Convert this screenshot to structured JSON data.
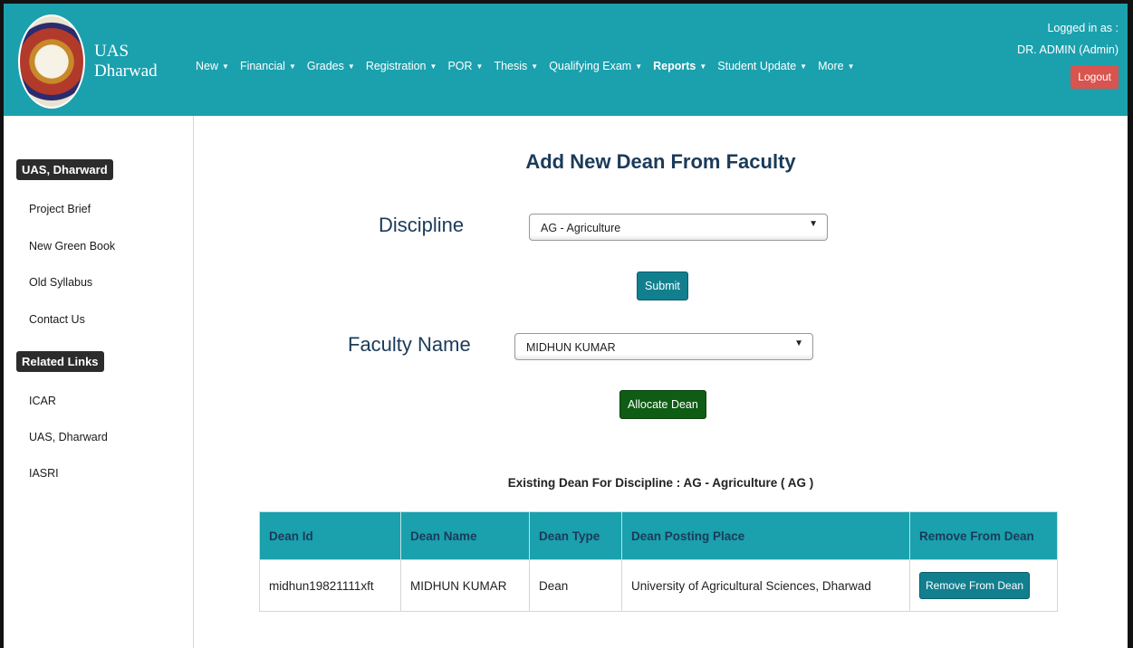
{
  "brand": {
    "line1": "UAS",
    "line2": "Dharwad"
  },
  "nav": [
    {
      "label": "New",
      "bold": false
    },
    {
      "label": "Financial",
      "bold": false
    },
    {
      "label": "Grades",
      "bold": false
    },
    {
      "label": "Registration",
      "bold": false
    },
    {
      "label": "POR",
      "bold": false
    },
    {
      "label": "Thesis",
      "bold": false
    },
    {
      "label": "Qualifying Exam",
      "bold": false
    },
    {
      "label": "Reports",
      "bold": true
    },
    {
      "label": "Student Update",
      "bold": false
    },
    {
      "label": "More",
      "bold": false
    }
  ],
  "login": {
    "label": "Logged in as :",
    "user": "DR. ADMIN (Admin)",
    "logout": "Logout"
  },
  "sidebar": {
    "section1": "UAS, Dharward",
    "links1": [
      "Project Brief",
      "New Green Book",
      "Old Syllabus",
      "Contact Us"
    ],
    "section2": "Related Links",
    "links2": [
      "ICAR",
      "UAS, Dharward",
      "IASRI"
    ]
  },
  "form": {
    "title": "Add New Dean From Faculty",
    "discipline_label": "Discipline",
    "discipline_value": "AG - Agriculture",
    "submit": "Submit",
    "faculty_label": "Faculty Name",
    "faculty_value": "MIDHUN KUMAR",
    "allocate": "Allocate Dean"
  },
  "existing": {
    "heading": "Existing Dean For Discipline : AG - Agriculture ( AG )",
    "columns": [
      "Dean Id",
      "Dean Name",
      "Dean Type",
      "Dean Posting Place",
      "Remove From Dean"
    ],
    "rows": [
      {
        "id": "midhun19821111xft",
        "name": "MIDHUN KUMAR",
        "type": "Dean",
        "place": "University of Agricultural Sciences, Dharwad",
        "action": "Remove From Dean"
      }
    ]
  },
  "colors": {
    "header": "#1ba0ad",
    "button": "#127f8f",
    "allocate": "#0f5c15",
    "logout": "#d9534f"
  }
}
